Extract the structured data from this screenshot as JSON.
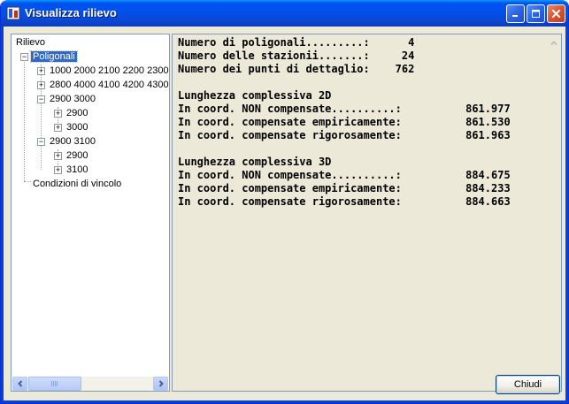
{
  "window": {
    "title": "Visualizza rilievo"
  },
  "tree": {
    "root": "Rilievo",
    "poligonali": "Poligonali",
    "items": [
      {
        "label": "1000 2000 2100 2200 2300",
        "expander": "+"
      },
      {
        "label": "2800 4000 4100 4200 4300",
        "expander": "+"
      },
      {
        "label": "2900 3000",
        "expander": "−"
      },
      {
        "label": "2900",
        "expander": "+"
      },
      {
        "label": "3000",
        "expander": "+"
      },
      {
        "label": "2900 3100",
        "expander": "−"
      },
      {
        "label": "2900",
        "expander": "+"
      },
      {
        "label": "3100",
        "expander": "+"
      }
    ],
    "vincoli": "Condizioni di vincolo"
  },
  "report": {
    "lines": [
      "Numero di poligonali.........:      4",
      "Numero delle stazionii.......:     24",
      "Numero dei punti di dettaglio:    762",
      "",
      "Lunghezza complessiva 2D",
      "In coord. NON compensate..........:          861.977",
      "In coord. compensate empiricamente:          861.530",
      "In coord. compensate rigorosamente:          861.963",
      "",
      "Lunghezza complessiva 3D",
      "In coord. NON compensate..........:          884.675",
      "In coord. compensate empiricamente:          884.233",
      "In coord. compensate rigorosamente:          884.663"
    ]
  },
  "buttons": {
    "close_label": "Chiudi"
  },
  "colors": {
    "titlebar": "#0053ee",
    "selection": "#316ac5",
    "window_bg": "#ece9d8"
  }
}
